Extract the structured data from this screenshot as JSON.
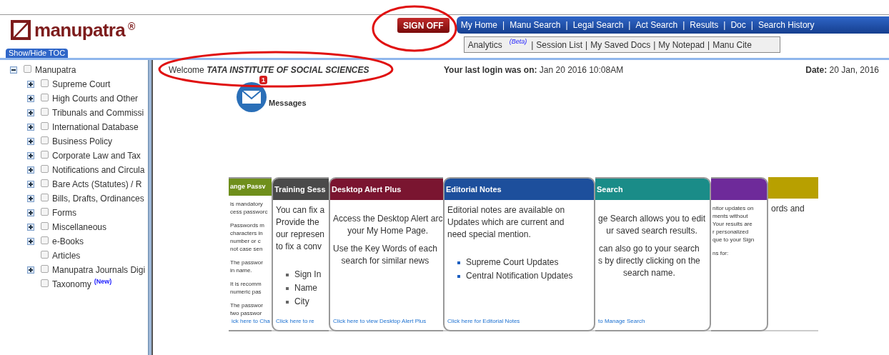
{
  "header": {
    "logo_text": "manupatra",
    "logo_mark": "®",
    "sign_off": "SIGN OFF",
    "nav": {
      "separator": "|",
      "items": [
        "My Home",
        "Manu Search",
        "Legal Search",
        "Act Search",
        "Results",
        "Doc",
        "Search History"
      ]
    },
    "submenu": {
      "separator": "|",
      "items": [
        {
          "label": "Analytics",
          "badge": "(Beta)"
        },
        {
          "label": "Session List"
        },
        {
          "label": "My Saved Docs"
        },
        {
          "label": "My Notepad"
        },
        {
          "label": "Manu Cite"
        }
      ]
    }
  },
  "toc_toggle": "Show/Hide TOC",
  "toc": [
    {
      "label": "Manupatra",
      "checked": false,
      "kind": "folder",
      "expanded": true,
      "children": [
        {
          "label": "Supreme Court",
          "checked": false,
          "kind": "folder",
          "expanded": false
        },
        {
          "label": "High Courts and Other",
          "checked": false,
          "kind": "folder",
          "expanded": false
        },
        {
          "label": "Tribunals and Commissi",
          "checked": false,
          "kind": "folder",
          "expanded": false
        },
        {
          "label": "International Database",
          "checked": false,
          "kind": "folder",
          "expanded": false
        },
        {
          "label": "Business Policy",
          "checked": false,
          "kind": "folder",
          "expanded": false
        },
        {
          "label": "Corporate Law and Tax",
          "checked": false,
          "kind": "folder",
          "expanded": false
        },
        {
          "label": "Notifications and Circula",
          "checked": false,
          "kind": "folder",
          "expanded": false
        },
        {
          "label": "Bare Acts (Statutes) / R",
          "checked": false,
          "kind": "folder",
          "expanded": false
        },
        {
          "label": "Bills, Drafts, Ordinances",
          "checked": false,
          "kind": "folder",
          "expanded": false
        },
        {
          "label": "Forms",
          "checked": false,
          "kind": "folder",
          "expanded": false
        },
        {
          "label": "Miscellaneous",
          "checked": false,
          "kind": "folder",
          "expanded": false
        },
        {
          "label": "e-Books",
          "checked": false,
          "kind": "folder",
          "expanded": false
        },
        {
          "label": "Articles",
          "checked": false,
          "kind": "leaf"
        },
        {
          "label": "Manupatra Journals Digi",
          "checked": false,
          "kind": "folder",
          "expanded": false
        },
        {
          "label": "Taxonomy",
          "checked": false,
          "kind": "leaf",
          "badge": "(New)"
        }
      ]
    }
  ],
  "welcome": "Welcome *TATA INSTITUTE OF SOCIAL SCIENCES*",
  "last_login": "**Your last login was on:** Jan 20 2016 10:08AM",
  "date": "**Date:** 20 Jan, 2016",
  "messages": {
    "label": "Messages",
    "count": "1"
  },
  "cards": [
    {
      "title": "ange Passv",
      "color": "#6f8f1c",
      "blocks": [
        {
          "kind": "text",
          "lines": [
            "is mandatory",
            "cess passworc"
          ]
        },
        {
          "kind": "text",
          "lines": [
            "Passwords m",
            "characters in",
            "number or c",
            "not case sen"
          ]
        },
        {
          "kind": "text",
          "lines": [
            "The passwor",
            "in name."
          ]
        },
        {
          "kind": "text",
          "lines": [
            "It is recomm",
            "numeric pas"
          ]
        },
        {
          "kind": "text",
          "lines": [
            "The passwor",
            "two passwor"
          ]
        }
      ],
      "link": "ick here to Cha"
    },
    {
      "title": "Training Sess",
      "color": "#4a4a4a",
      "blocks": [
        {
          "kind": "text",
          "lines": [
            "You can fix a",
            "Provide the",
            "our represen",
            "to fix a conv"
          ]
        },
        {
          "kind": "bullets",
          "lines": [
            "Sign In",
            "Name",
            "City"
          ]
        }
      ],
      "link": "Click here to re"
    },
    {
      "title": "Desktop Alert Plus",
      "color": "#7a1530",
      "blocks": [
        {
          "kind": "center",
          "lines": [
            "Access the Desktop Alert arc",
            "your My Home Page."
          ]
        },
        {
          "kind": "center",
          "lines": [
            "Use the Key Words of each",
            "search for similar news"
          ]
        }
      ],
      "link": "Click here to view Desktop Alert Plus"
    },
    {
      "title": "Editorial Notes",
      "color": "#1d4f9c",
      "blocks": [
        {
          "kind": "text",
          "lines": [
            "Editorial notes are available on",
            "Updates which are current and",
            "need special mention."
          ]
        },
        {
          "kind": "bullets",
          "lines": [
            "Supreme Court Updates",
            "Central Notification Updates"
          ]
        }
      ],
      "link": "Click here for Editorial Notes"
    },
    {
      "title": "Search",
      "color": "#1a8c88",
      "blocks": [
        {
          "kind": "center",
          "lines": [
            "ge Search allows you to edit",
            "ur saved search results."
          ]
        },
        {
          "kind": "center",
          "lines": [
            "can also go to your search",
            "s by directly clicking on the",
            "search name."
          ]
        }
      ],
      "link": "to Manage Search"
    },
    {
      "color": "#6e2a9a",
      "blocks": [
        {
          "kind": "text",
          "lines": [
            "nitor updates on",
            "ments without",
            "Your results are",
            "r personalized",
            "que to your Sign"
          ]
        },
        {
          "kind": "text",
          "lines": [
            "ns for:"
          ]
        }
      ]
    },
    {
      "color": "#b8a000",
      "blocks": [
        {
          "kind": "text",
          "lines": [
            "ords and"
          ]
        }
      ]
    }
  ]
}
